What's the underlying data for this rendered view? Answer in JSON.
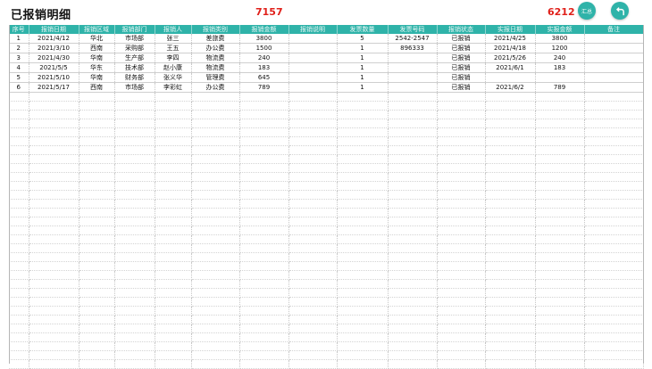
{
  "header": {
    "title": "已报销明细",
    "total_amount": "7157",
    "total_actual": "6212",
    "summary_button_label": "汇总"
  },
  "colors": {
    "accent": "#2fb3a9",
    "highlight": "#e0201a"
  },
  "table": {
    "columns": [
      "序号",
      "报销日期",
      "报销区域",
      "报销部门",
      "报销人",
      "报销类别",
      "报销金额",
      "报销说明",
      "发票数量",
      "发票号码",
      "报销状态",
      "实报日期",
      "实报金额",
      "备注"
    ],
    "rows": [
      [
        "1",
        "2021/4/12",
        "华北",
        "市场部",
        "张三",
        "差旅费",
        "3800",
        "",
        "5",
        "2542-2547",
        "已报销",
        "2021/4/25",
        "3800",
        ""
      ],
      [
        "2",
        "2021/3/10",
        "西南",
        "采购部",
        "王五",
        "办公费",
        "1500",
        "",
        "1",
        "896333",
        "已报销",
        "2021/4/18",
        "1200",
        ""
      ],
      [
        "3",
        "2021/4/30",
        "华南",
        "生产部",
        "李四",
        "物流费",
        "240",
        "",
        "1",
        "",
        "已报销",
        "2021/5/26",
        "240",
        ""
      ],
      [
        "4",
        "2021/5/5",
        "华东",
        "技术部",
        "赵小康",
        "物流费",
        "183",
        "",
        "1",
        "",
        "已报销",
        "2021/6/1",
        "183",
        ""
      ],
      [
        "5",
        "2021/5/10",
        "华南",
        "财务部",
        "张义华",
        "管理费",
        "645",
        "",
        "1",
        "",
        "已报销",
        "",
        "",
        ""
      ],
      [
        "6",
        "2021/5/17",
        "西南",
        "市场部",
        "李彩虹",
        "办公费",
        "789",
        "",
        "1",
        "",
        "已报销",
        "2021/6/2",
        "789",
        ""
      ]
    ]
  }
}
